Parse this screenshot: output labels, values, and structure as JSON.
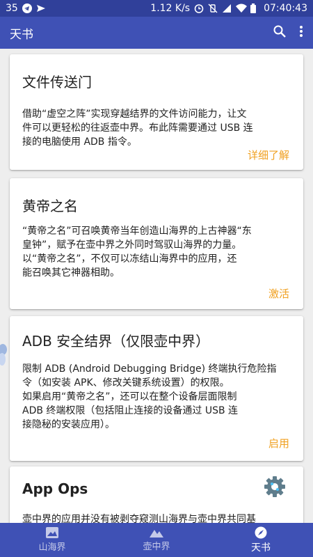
{
  "status_bar": {
    "left_text": "35",
    "speed": "1.12 K/s",
    "time": "07:40:43",
    "icons": [
      "telegram-icon",
      "send-icon",
      "alarm-icon",
      "vibrate-off-icon",
      "signal-icon",
      "wifi-icon",
      "battery-icon"
    ]
  },
  "app_bar": {
    "title": "天书",
    "icons": [
      "search-icon",
      "more-vert-icon"
    ]
  },
  "cards": [
    {
      "title": "文件传送门",
      "body_lines": [
        "借助“虚空之阵”实现穿越结界的文件访问能力，让文",
        "件可以更轻松的往返壶中界。布此阵需要通过 USB 连",
        "接的电脑使用 ADB 指令。"
      ],
      "action": "详细了解"
    },
    {
      "title": "黄帝之名",
      "body_lines": [
        "“黄帝之名”可召唤黄帝当年创造山海界的上古神器“东",
        "皇钟”，赋予在壶中界之外同时驾驭山海界的力量。",
        "以“黄帝之名”，不仅可以冻结山海界中的应用，还",
        "能召唤其它神器相助。"
      ],
      "action": "激活"
    },
    {
      "title": "ADB 安全结界（仅限壶中界）",
      "body_lines": [
        "限制 ADB (Android Debugging Bridge) 终端执行危险指",
        "令（如安装 APK、修改关键系统设置）的权限。",
        "如果启用“黄帝之名”，还可以在整个设备层面限制",
        "ADB 终端权限（包括阻止连接的设备通过 USB 连",
        "接隐秘的安装应用）。"
      ],
      "action": "启用"
    },
    {
      "title": "App Ops",
      "body_lines": [
        "壶中界的应用并没有被剥夺窥测山海界与壶中界共同基"
      ],
      "icon": "settings-gear-icon"
    }
  ],
  "bottom_nav": {
    "items": [
      {
        "label": "山海界",
        "icon": "image-icon"
      },
      {
        "label": "壶中界",
        "icon": "mountain-icon"
      },
      {
        "label": "天书",
        "icon": "compass-icon"
      }
    ],
    "active_index": 2
  },
  "colors": {
    "primary": "#3f51b5",
    "status_bar": "#30409a",
    "accent": "#f0a020",
    "background": "#eeeeee"
  }
}
